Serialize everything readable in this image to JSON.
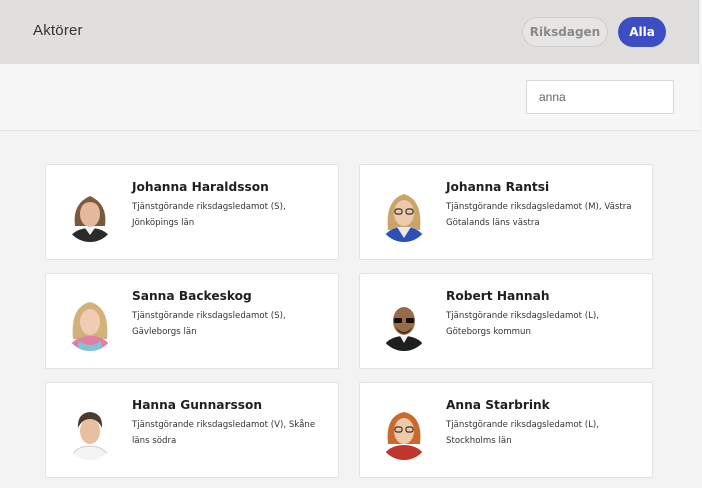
{
  "header": {
    "title": "Aktörer",
    "buttons": {
      "riksdagen": "Riksdagen",
      "alla": "Alla"
    }
  },
  "search": {
    "value": "anna",
    "placeholder": ""
  },
  "people": [
    {
      "name": "Johanna Haraldsson",
      "description": "Tjänstgörande riksdagsledamot (S), Jönköpings län"
    },
    {
      "name": "Johanna Rantsi",
      "description": "Tjänstgörande riksdagsledamot (M), Västra Götalands läns västra"
    },
    {
      "name": "Sanna Backeskog",
      "description": "Tjänstgörande riksdagsledamot (S), Gävleborgs län"
    },
    {
      "name": "Robert Hannah",
      "description": "Tjänstgörande riksdagsledamot (L), Göteborgs kommun"
    },
    {
      "name": "Hanna Gunnarsson",
      "description": "Tjänstgörande riksdagsledamot (V), Skåne läns södra"
    },
    {
      "name": "Anna Starbrink",
      "description": "Tjänstgörande riksdagsledamot (L), Stockholms län"
    }
  ],
  "colors": {
    "accent": "#3d4ec4",
    "header_bg": "#e0dfde"
  }
}
